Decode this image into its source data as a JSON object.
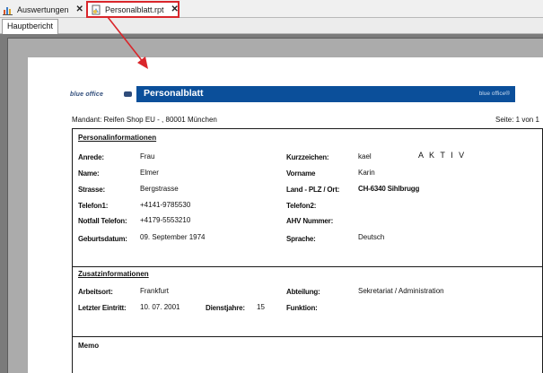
{
  "tabs": [
    {
      "label": "Auswertungen",
      "close": "✕"
    },
    {
      "label": "Personalblatt.rpt",
      "close": "✕"
    }
  ],
  "subtab": {
    "label": "Hauptbericht"
  },
  "header": {
    "logo": "blue office",
    "title": "Personalblatt",
    "brand": "blue office®",
    "bar_color": "#0b4f9a"
  },
  "mandant": "Mandant: Reifen Shop EU - , 80001 München",
  "page": "Seite: 1 von 1",
  "personal": {
    "title": "Personalinformationen",
    "anrede_label": "Anrede:",
    "anrede": "Frau",
    "kurz_label": "Kurzzeichen:",
    "kurz": "kael",
    "status": "A K T I V",
    "name_label": "Name:",
    "name": "Elmer",
    "vorname_label": "Vorname",
    "vorname": "Karin",
    "strasse_label": "Strasse:",
    "strasse": "Bergstrasse",
    "land_label": "Land - PLZ / Ort:",
    "land": "CH-6340 Sihlbrugg",
    "tel1_label": "Telefon1:",
    "tel1": "+4141-9785530",
    "tel2_label": "Telefon2:",
    "notfall_label": "Notfall Telefon:",
    "notfall": "+4179-5553210",
    "ahv_label": "AHV Nummer:",
    "geb_label": "Geburtsdatum:",
    "geb": "09. September 1974",
    "sprache_label": "Sprache:",
    "sprache": "Deutsch"
  },
  "zusatz": {
    "title": "Zusatzinformationen",
    "arbeitsort_label": "Arbeitsort:",
    "arbeitsort": "Frankfurt",
    "abteilung_label": "Abteilung:",
    "abteilung": "Sekretariat / Administration",
    "eintritt_label": "Letzter Eintritt:",
    "eintritt": "10. 07. 2001",
    "dienstjahre_label": "Dienstjahre:",
    "dienstjahre": "15",
    "funktion_label": "Funktion:"
  },
  "memo": {
    "title": "Memo"
  },
  "colors": {
    "highlight": "#d9262b",
    "viewer_bg": "#ababab"
  }
}
